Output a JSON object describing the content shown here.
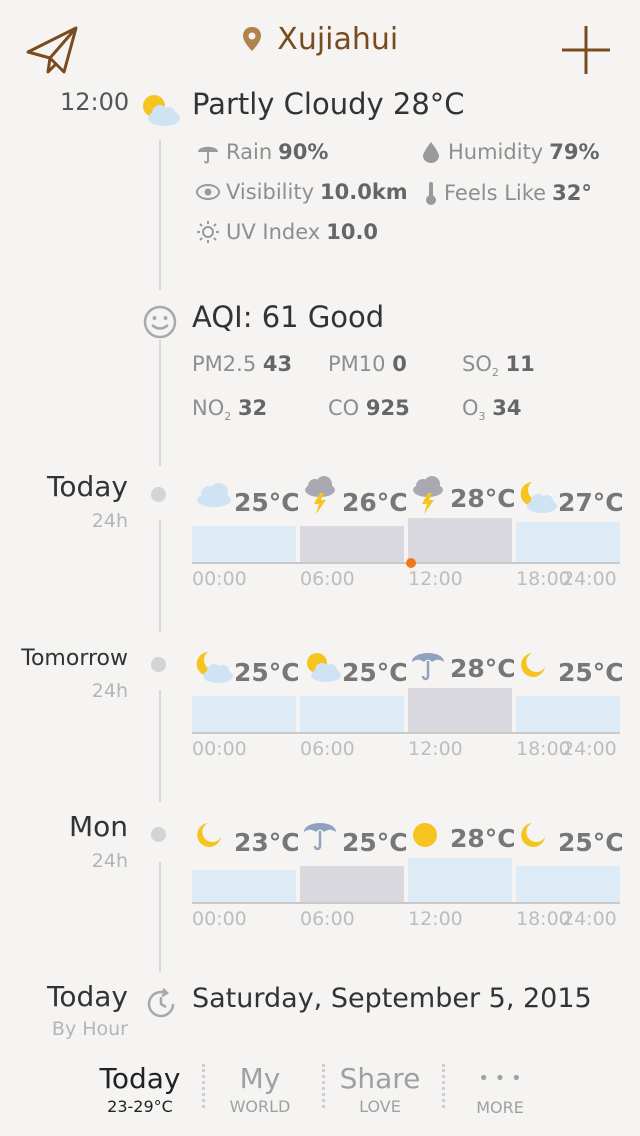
{
  "header": {
    "location": "Xujiahui"
  },
  "current": {
    "time": "12:00",
    "title": "Partly Cloudy 28°C",
    "rain_label": "Rain",
    "rain_value": "90%",
    "humidity_label": "Humidity",
    "humidity_value": "79%",
    "visibility_label": "Visibility",
    "visibility_value": "10.0km",
    "feels_label": "Feels Like",
    "feels_value": "32°",
    "uv_label": "UV Index",
    "uv_value": "10.0"
  },
  "aqi": {
    "title": "AQI: 61 Good",
    "pm25_label": "PM2.5",
    "pm25_value": "43",
    "pm10_label": "PM10",
    "pm10_value": "0",
    "so2_label": "SO",
    "so2_sub": "2",
    "so2_value": "11",
    "no2_label": "NO",
    "no2_sub": "2",
    "no2_value": "32",
    "co_label": "CO",
    "co_value": "925",
    "o3_label": "O",
    "o3_sub": "3",
    "o3_value": "34"
  },
  "ticks": [
    "00:00",
    "06:00",
    "12:00",
    "18:00",
    "24:00"
  ],
  "days": [
    {
      "name": "Today",
      "sub": "24h",
      "segments": [
        {
          "icon": "cloud-icon",
          "temp": "25°C",
          "level": 0.45
        },
        {
          "icon": "thunderstorm-icon",
          "temp": "26°C",
          "level": 0.45
        },
        {
          "icon": "thunderstorm-icon",
          "temp": "28°C",
          "level": 0.55
        },
        {
          "icon": "moon-cloud-icon",
          "temp": "27°C",
          "level": 0.5
        }
      ]
    },
    {
      "name": "Tomorrow",
      "sub": "24h",
      "segments": [
        {
          "icon": "moon-cloud-icon",
          "temp": "25°C",
          "level": 0.45
        },
        {
          "icon": "sun-cloud-icon",
          "temp": "25°C",
          "level": 0.45
        },
        {
          "icon": "umbrella-icon",
          "temp": "28°C",
          "level": 0.55
        },
        {
          "icon": "moon-icon",
          "temp": "25°C",
          "level": 0.45
        }
      ]
    },
    {
      "name": "Mon",
      "sub": "24h",
      "segments": [
        {
          "icon": "moon-icon",
          "temp": "23°C",
          "level": 0.4
        },
        {
          "icon": "umbrella-icon",
          "temp": "25°C",
          "level": 0.45
        },
        {
          "icon": "sun-icon",
          "temp": "28°C",
          "level": 0.55
        },
        {
          "icon": "moon-icon",
          "temp": "25°C",
          "level": 0.45
        }
      ]
    }
  ],
  "hourly": {
    "name": "Today",
    "sub": "By Hour",
    "date": "Saturday, September 5, 2015"
  },
  "nav": [
    {
      "main": "Today",
      "sub": "23-29°C"
    },
    {
      "main": "My",
      "sub": "WORLD"
    },
    {
      "main": "Share",
      "sub": "LOVE"
    },
    {
      "main": "• • •",
      "sub": "MORE"
    }
  ],
  "colors": {
    "accent": "#7a4b1e",
    "sky": "#dcebf6",
    "storm": "#d8d8de",
    "sun": "#f7c31e",
    "marker": "#f07a1a"
  }
}
